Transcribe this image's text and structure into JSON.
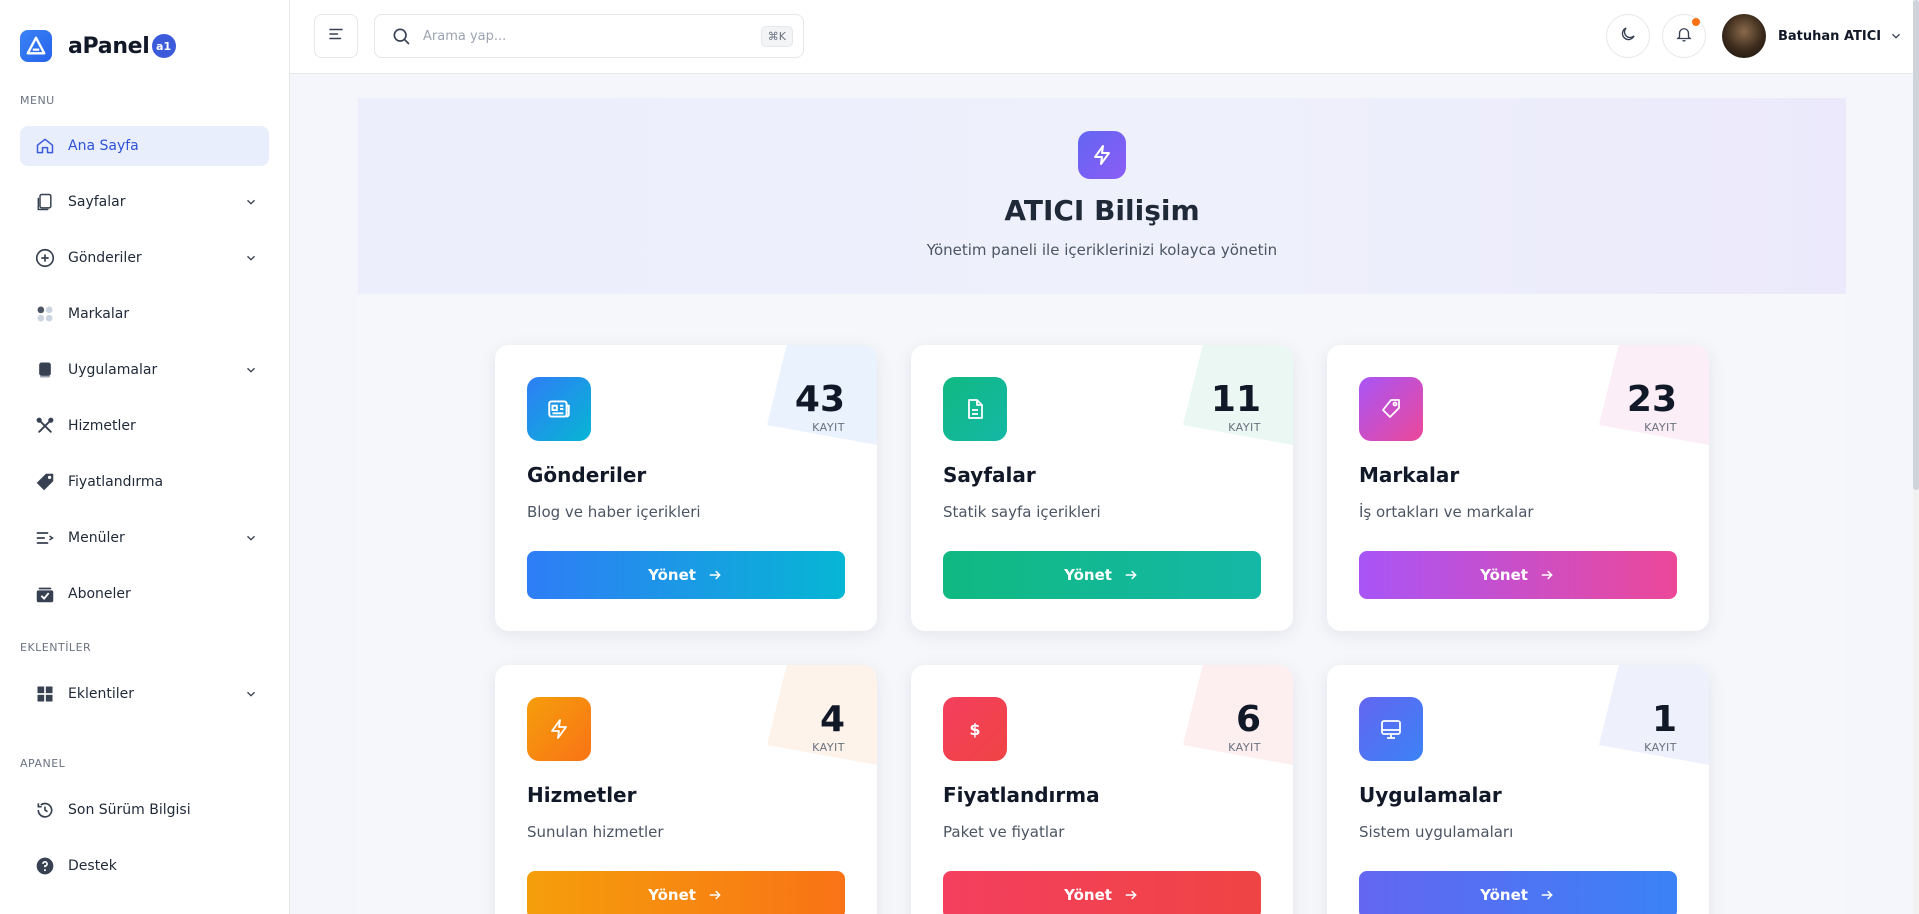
{
  "brand": {
    "name": "aPanel",
    "badge": "a1"
  },
  "sidebar": {
    "sections": {
      "menu": "MENU",
      "plugins": "EKLENTİLER",
      "apanel": "APANEL"
    },
    "items": [
      {
        "label": "Ana Sayfa",
        "icon": "home-icon",
        "active": true
      },
      {
        "label": "Sayfalar",
        "icon": "pages-icon",
        "expandable": true
      },
      {
        "label": "Gönderiler",
        "icon": "plus-circle-icon",
        "expandable": true
      },
      {
        "label": "Markalar",
        "icon": "brands-icon"
      },
      {
        "label": "Uygulamalar",
        "icon": "app-icon",
        "expandable": true
      },
      {
        "label": "Hizmetler",
        "icon": "tools-icon"
      },
      {
        "label": "Fiyatlandırma",
        "icon": "price-tag-icon"
      },
      {
        "label": "Menüler",
        "icon": "menu-list-icon",
        "expandable": true
      },
      {
        "label": "Aboneler",
        "icon": "subscribers-icon"
      },
      {
        "label": "Eklentiler",
        "icon": "grid-icon",
        "expandable": true
      },
      {
        "label": "Son Sürüm Bilgisi",
        "icon": "history-icon"
      },
      {
        "label": "Destek",
        "icon": "help-icon"
      }
    ]
  },
  "topbar": {
    "search_placeholder": "Arama yap...",
    "search_shortcut": "⌘K",
    "user_name": "Batuhan ATICI",
    "has_notification": true
  },
  "hero": {
    "title": "ATICI Bilişim",
    "subtitle": "Yönetim paneli ile içeriklerinizi kolayca yönetin"
  },
  "cards": [
    {
      "title": "Gönderiler",
      "desc": "Blog ve haber içerikleri",
      "count": "43",
      "unit": "KAYIT",
      "button": "Yönet",
      "icon": "newspaper-icon",
      "color_from": "#2f7df6",
      "color_to": "#06b6d4",
      "tint": "#eaf3fd"
    },
    {
      "title": "Sayfalar",
      "desc": "Statik sayfa içerikleri",
      "count": "11",
      "unit": "KAYIT",
      "button": "Yönet",
      "icon": "document-icon",
      "color_from": "#10b981",
      "color_to": "#14b8a6",
      "tint": "#eaf7f2"
    },
    {
      "title": "Markalar",
      "desc": "İş ortakları ve markalar",
      "count": "23",
      "unit": "KAYIT",
      "button": "Yönet",
      "icon": "tag-icon",
      "color_from": "#a855f7",
      "color_to": "#ec4899",
      "tint": "#fbeef6"
    },
    {
      "title": "Hizmetler",
      "desc": "Sunulan hizmetler",
      "count": "4",
      "unit": "KAYIT",
      "button": "Yönet",
      "icon": "bolt-icon",
      "color_from": "#f59e0b",
      "color_to": "#f97316",
      "tint": "#fdf3ea"
    },
    {
      "title": "Fiyatlandırma",
      "desc": "Paket ve fiyatlar",
      "count": "6",
      "unit": "KAYIT",
      "button": "Yönet",
      "icon": "dollar-icon",
      "color_from": "#f43f5e",
      "color_to": "#ef4444",
      "tint": "#fdeef0"
    },
    {
      "title": "Uygulamalar",
      "desc": "Sistem uygulamaları",
      "count": "1",
      "unit": "KAYIT",
      "button": "Yönet",
      "icon": "monitor-icon",
      "color_from": "#6366f1",
      "color_to": "#3b82f6",
      "tint": "#eef1fb"
    }
  ]
}
